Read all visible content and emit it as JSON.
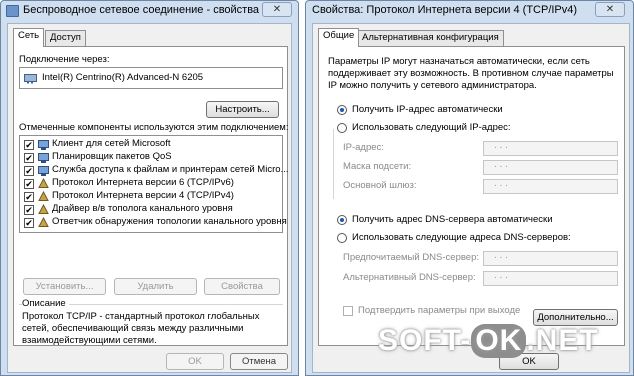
{
  "win1": {
    "title": "Беспроводное сетевое соединение - свойства",
    "close": "✕",
    "tabs": [
      "Сеть",
      "Доступ"
    ],
    "connect_label": "Подключение через:",
    "adapter": "Intel(R) Centrino(R) Advanced-N 6205",
    "configure": "Настроить...",
    "components_label": "Отмеченные компоненты используются этим подключением:",
    "components": [
      "Клиент для сетей Microsoft",
      "Планировщик пакетов QoS",
      "Служба доступа к файлам и принтерам сетей Micro...",
      "Протокол Интернета версии 6 (TCP/IPv6)",
      "Протокол Интернета версии 4 (TCP/IPv4)",
      "Драйвер в/в тополога канального уровня",
      "Ответчик обнаружения топологии канального уровня"
    ],
    "install": "Установить...",
    "remove": "Удалить",
    "properties": "Свойства",
    "desc_title": "Описание",
    "desc_text": [
      "Протокол TCP/IP - стандартный протокол глобальных",
      "сетей, обеспечивающий связь между различными",
      "взаимодействующими сетями."
    ],
    "ok": "OK",
    "cancel": "Отмена"
  },
  "win2": {
    "title": "Свойства: Протокол Интернета версии 4 (TCP/IPv4)",
    "close": "✕",
    "tabs": [
      "Общие",
      "Альтернативная конфигурация"
    ],
    "info": [
      "Параметры IP могут назначаться автоматически, если сеть",
      "поддерживает эту возможность. В противном случае параметры",
      "IP можно получить у сетевого администратора."
    ],
    "radio_auto_ip": "Получить IP-адрес автоматически",
    "radio_manual_ip": "Использовать следующий IP-адрес:",
    "ip_label": "IP-адрес:",
    "mask_label": "Маска подсети:",
    "gateway_label": "Основной шлюз:",
    "radio_auto_dns": "Получить адрес DNS-сервера автоматически",
    "radio_manual_dns": "Использовать следующие адреса DNS-серверов:",
    "dns1_label": "Предпочитаемый DNS-сервер:",
    "dns2_label": "Альтернативный DNS-сервер:",
    "ip_dots": ". . .",
    "validate": "Подтвердить параметры при выходе",
    "advanced": "Дополнительно...",
    "ok": "OK"
  },
  "watermark": {
    "left": "SOFT-",
    "mid": "OK",
    "right": ".NET"
  }
}
